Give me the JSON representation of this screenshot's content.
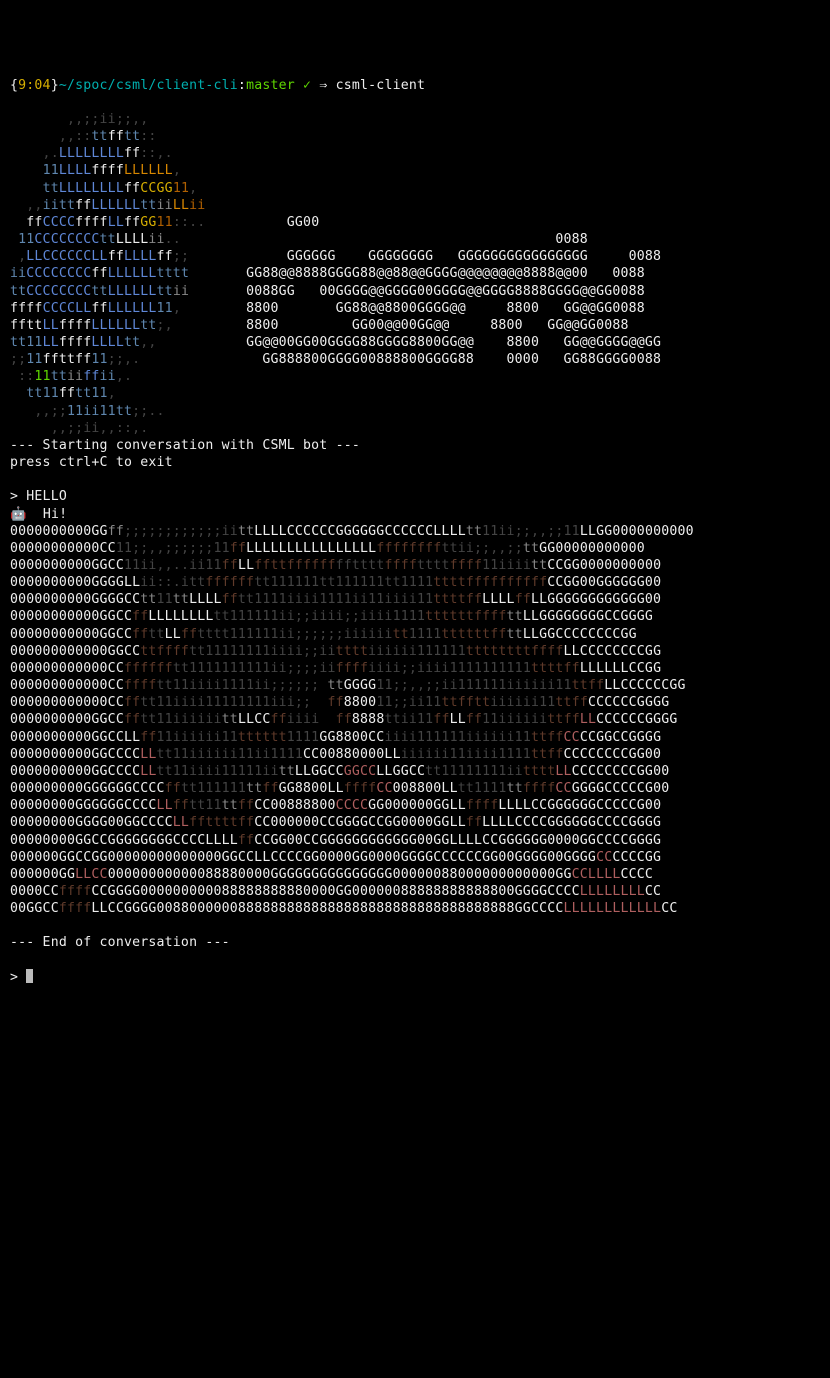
{
  "prompt": {
    "time_open": "{",
    "time": "9:04",
    "time_close": "}",
    "path": "~/spoc/csml/client-cli",
    "sep": ":",
    "branch": "master",
    "status": " ✓",
    "arrow": " ⇒ ",
    "command": "csml-client"
  },
  "logo": {
    "l01": "       ,,;;ii;;,,",
    "l02a": "      ,,::",
    "l02b": "tt",
    "l02c": "ff",
    "l02d": "tt",
    "l02e": "::",
    "l03a": "    ,.",
    "l03b": "LLLLLLLL",
    "l03c": "ff",
    "l03d": "::,.",
    "l04a": "    ",
    "l04b": "11",
    "l04c": "LLLL",
    "l04d": "ffff",
    "l04e": "LLLLLL",
    "l04f": ",",
    "l05a": "    ",
    "l05b": "tt",
    "l05c": "LLLLLLLL",
    "l05d": "ff",
    "l05e": "CCGG",
    "l05f": "11",
    "l05g": ",",
    "l06a": "  ,,",
    "l06b": "iitt",
    "l06c": "ff",
    "l06d": "LLLLLL",
    "l06e": "tt",
    "l06f": "ii",
    "l06g": "LL",
    "l06h": "ii",
    "l07a": "  ",
    "l07b": "ff",
    "l07c": "CCCC",
    "l07d": "ffff",
    "l07e": "LL",
    "l07f": "ff",
    "l07g": "GG",
    "l07h": "11",
    "l07i": "::..",
    "l07z": "          GG00",
    "l08a": " ",
    "l08b": "11",
    "l08c": "CCCCCCCC",
    "l08d": "tt",
    "l08e": "LLLL",
    "l08f": "ii",
    "l08g": "..",
    "l08z": "           0088",
    "l09a": " ,",
    "l09b": "LL",
    "l09c": "CCCCCC",
    "l09d": "LL",
    "l09e": "ff",
    "l09f": "LLLL",
    "l09g": "ff",
    "l09h": ";;",
    "l09z": "GGGGGG    GGGGGGGG   GGGGGGGGGGGGGGGG     0088",
    "l10a": "ii",
    "l10b": "CCCCCCCC",
    "l10c": "ff",
    "l10d": "LLLLLL",
    "l10e": "tttt",
    "l10z": "GG88@@8888GGGG88@@88@@GGGG@@@@@@@@8888@@00   0088",
    "l11a": "tt",
    "l11b": "CCCCCCCC",
    "l11c": "tt",
    "l11d": "LLLLLL",
    "l11e": "tt",
    "l11f": "ii",
    "l11z": "0088GG   00GGGG@@GGGG00GGGG@@GGGG8888GGGG@@GG0088",
    "l12a": "ffff",
    "l12b": "CCCC",
    "l12c": "LL",
    "l12d": "ff",
    "l12e": "LLLLLL",
    "l12f": "11",
    "l12g": ",",
    "l12z": "8800       GG88@@8800GGGG@@     8800   GG@@GG0088",
    "l13a": "fftt",
    "l13b": "LL",
    "l13c": "ffff",
    "l13d": "LLLLLL",
    "l13e": "tt",
    "l13f": ";,",
    "l13z": "8800         GG00@@00GG@@     8800   GG@@GG0088",
    "l14a": "tt",
    "l14b": "11",
    "l14c": "LL",
    "l14d": "ffff",
    "l14e": "LLLL",
    "l14f": "tt",
    "l14g": ",,",
    "l14z": "GG@@00GG00GGGG88GGGG8800GG@@    8800   GG@@GGGG@@GG",
    "l15a": ";;",
    "l15b": "11",
    "l15c": "fftt",
    "l15d": "ff",
    "l15e": "11",
    "l15f": ";;,.",
    "l15z": "GG888800GGGG00888800GGGG88    0000   GG88GGGG0088",
    "l16a": " ::",
    "l16b": "11",
    "l16c": "tt",
    "l16d": "ii",
    "l16e": "ff",
    "l16f": "ii",
    "l16g": ",.",
    "l17a": "  ",
    "l17b": "tt",
    "l17c": "11",
    "l17d": "ff",
    "l17e": "tt",
    "l17f": "11",
    "l17g": ",",
    "l18a": "   ,,;;",
    "l18b": "11",
    "l18c": "ii",
    "l18d": "11",
    "l18e": "tt",
    "l18f": ";;..",
    "l19": "     ,,;;ii,,::,."
  },
  "conv": {
    "start": "--- Starting conversation with CSML bot ---",
    "exit": "press ctrl+C to exit",
    "user_prefix": "> ",
    "user_msg": "HELLO",
    "bot_icon": "🤖",
    "bot_msg": "  Hi!",
    "end": "--- End of conversation ---"
  },
  "art": [
    {
      "p": [
        {
          "c": "c-white",
          "t": "0000000000GG"
        },
        {
          "c": "c-grey",
          "t": "ff"
        },
        {
          "c": "c-dim",
          "t": ";;;;;;;;;;;;ii"
        },
        {
          "c": "c-grey",
          "t": "tt"
        },
        {
          "c": "c-white",
          "t": "LLLLCCCCCCGGGGGGCCCCCCLLLL"
        },
        {
          "c": "c-grey",
          "t": "tt"
        },
        {
          "c": "c-dim",
          "t": "11ii;;,,;;11"
        },
        {
          "c": "c-white",
          "t": "LLGG0000000000"
        }
      ]
    },
    {
      "p": [
        {
          "c": "c-white",
          "t": "00000000000CC"
        },
        {
          "c": "c-dim",
          "t": "11;;,,;;;;;;11"
        },
        {
          "c": "c-brown",
          "t": "ff"
        },
        {
          "c": "c-white",
          "t": "LLLLLLLLLLLLLLLL"
        },
        {
          "c": "c-brown",
          "t": "ffffffff"
        },
        {
          "c": "c-dim",
          "t": "ttii;;,,;;"
        },
        {
          "c": "c-grey",
          "t": "tt"
        },
        {
          "c": "c-white",
          "t": "GG00000000000"
        }
      ]
    },
    {
      "p": [
        {
          "c": "c-white",
          "t": "0000000000GGCC"
        },
        {
          "c": "c-dim",
          "t": "11ii,,..ii11"
        },
        {
          "c": "c-brown",
          "t": "ff"
        },
        {
          "c": "c-white",
          "t": "LL"
        },
        {
          "c": "c-brown",
          "t": "fftt"
        },
        {
          "c": "c-brown",
          "t": "ffffff"
        },
        {
          "c": "c-dim",
          "t": "fftttt"
        },
        {
          "c": "c-brown",
          "t": "ffff"
        },
        {
          "c": "c-dim",
          "t": "tttt"
        },
        {
          "c": "c-brown",
          "t": "ffff"
        },
        {
          "c": "c-dim",
          "t": "11iiii"
        },
        {
          "c": "c-grey",
          "t": "tt"
        },
        {
          "c": "c-white",
          "t": "CCGG0000000000"
        }
      ]
    },
    {
      "p": [
        {
          "c": "c-white",
          "t": "0000000000GGGGLL"
        },
        {
          "c": "c-dim",
          "t": "ii::.itt"
        },
        {
          "c": "c-brown",
          "t": "ffffff"
        },
        {
          "c": "c-dim",
          "t": "tt111111tt111111tt1111"
        },
        {
          "c": "c-brown",
          "t": "tttt"
        },
        {
          "c": "c-brown",
          "t": "ffff"
        },
        {
          "c": "c-brown",
          "t": "ffffff"
        },
        {
          "c": "c-white",
          "t": "CCGG00GGGGGG00"
        }
      ]
    },
    {
      "p": [
        {
          "c": "c-white",
          "t": "0000000000GGGGCC"
        },
        {
          "c": "c-grey",
          "t": "tt"
        },
        {
          "c": "c-dim",
          "t": "11"
        },
        {
          "c": "c-grey",
          "t": "tt"
        },
        {
          "c": "c-white",
          "t": "LLLL"
        },
        {
          "c": "c-brown",
          "t": "ff"
        },
        {
          "c": "c-dim",
          "t": "tt1111iiii1111ii11iiii11"
        },
        {
          "c": "c-brown",
          "t": "tttt"
        },
        {
          "c": "c-brown",
          "t": "ff"
        },
        {
          "c": "c-white",
          "t": "LLLL"
        },
        {
          "c": "c-brown",
          "t": "ff"
        },
        {
          "c": "c-white",
          "t": "LLGGGGGGGGGGGG00"
        }
      ]
    },
    {
      "p": [
        {
          "c": "c-white",
          "t": "00000000000GGCC"
        },
        {
          "c": "c-brown",
          "t": "ff"
        },
        {
          "c": "c-white",
          "t": "LLLLLLLL"
        },
        {
          "c": "c-dim",
          "t": "tt111111ii;;iiii;;iiii1111"
        },
        {
          "c": "c-brown",
          "t": "tttttt"
        },
        {
          "c": "c-brown",
          "t": "ffff"
        },
        {
          "c": "c-grey",
          "t": "tt"
        },
        {
          "c": "c-white",
          "t": "LLGGGGGGGGCCGGGG"
        }
      ]
    },
    {
      "p": [
        {
          "c": "c-white",
          "t": "00000000000GGCC"
        },
        {
          "c": "c-brown",
          "t": "ff"
        },
        {
          "c": "c-dim",
          "t": "tt"
        },
        {
          "c": "c-white",
          "t": "LL"
        },
        {
          "c": "c-brown",
          "t": "ff"
        },
        {
          "c": "c-dim",
          "t": "tttt111111ii;;;;;;iiiiii"
        },
        {
          "c": "c-brown",
          "t": "tt"
        },
        {
          "c": "c-dim",
          "t": "1111"
        },
        {
          "c": "c-brown",
          "t": "tttttt"
        },
        {
          "c": "c-brown",
          "t": "ff"
        },
        {
          "c": "c-grey",
          "t": "tt"
        },
        {
          "c": "c-white",
          "t": "LLGGCCCCCCCCGG"
        }
      ]
    },
    {
      "p": [
        {
          "c": "c-white",
          "t": "000000000000GGCC"
        },
        {
          "c": "c-brown",
          "t": "tt"
        },
        {
          "c": "c-brown",
          "t": "ffff"
        },
        {
          "c": "c-dim",
          "t": "tt11111111iiii;;ii"
        },
        {
          "c": "c-brown",
          "t": "tttt"
        },
        {
          "c": "c-dim",
          "t": "iiiiii111111"
        },
        {
          "c": "c-brown",
          "t": "tttttttt"
        },
        {
          "c": "c-brown",
          "t": "ffff"
        },
        {
          "c": "c-white",
          "t": "LLCCCCCCCCGG"
        }
      ]
    },
    {
      "p": [
        {
          "c": "c-white",
          "t": "000000000000CC"
        },
        {
          "c": "c-brown",
          "t": "ffffff"
        },
        {
          "c": "c-dim",
          "t": "tt1111111111ii;;;;ii"
        },
        {
          "c": "c-brown",
          "t": "ffff"
        },
        {
          "c": "c-dim",
          "t": "iiii;;iiii1111111111"
        },
        {
          "c": "c-brown",
          "t": "tttt"
        },
        {
          "c": "c-brown",
          "t": "ff"
        },
        {
          "c": "c-white",
          "t": "LLLLLLCCGG"
        }
      ]
    },
    {
      "p": [
        {
          "c": "c-white",
          "t": "000000000000CC"
        },
        {
          "c": "c-brown",
          "t": "ffff"
        },
        {
          "c": "c-dim",
          "t": "tt11iiii1111ii;;;;;; "
        },
        {
          "c": "c-grey",
          "t": "tt"
        },
        {
          "c": "c-white",
          "t": "GGGG"
        },
        {
          "c": "c-dim",
          "t": "11;;,,;;ii111111iiiiii11"
        },
        {
          "c": "c-brown",
          "t": "tt"
        },
        {
          "c": "c-brown",
          "t": "ff"
        },
        {
          "c": "c-white",
          "t": "LLCCCCCCGG"
        }
      ]
    },
    {
      "p": [
        {
          "c": "c-white",
          "t": "000000000000CC"
        },
        {
          "c": "c-brown",
          "t": "ff"
        },
        {
          "c": "c-dim",
          "t": "tt11iiii11111111iii;;  "
        },
        {
          "c": "c-brown",
          "t": "ff"
        },
        {
          "c": "c-white",
          "t": "8800"
        },
        {
          "c": "c-dim",
          "t": "11;;ii11"
        },
        {
          "c": "c-brown",
          "t": "ttfftt"
        },
        {
          "c": "c-dim",
          "t": "iiiiii11"
        },
        {
          "c": "c-brown",
          "t": "tt"
        },
        {
          "c": "c-brown",
          "t": "ff"
        },
        {
          "c": "c-white",
          "t": "CCCCCCGGGG"
        }
      ]
    },
    {
      "p": [
        {
          "c": "c-white",
          "t": "0000000000GGCC"
        },
        {
          "c": "c-brown",
          "t": "ff"
        },
        {
          "c": "c-dim",
          "t": "tt11iiiiii"
        },
        {
          "c": "c-grey",
          "t": "tt"
        },
        {
          "c": "c-white",
          "t": "LLCC"
        },
        {
          "c": "c-brown",
          "t": "ff"
        },
        {
          "c": "c-dim",
          "t": "iiii  "
        },
        {
          "c": "c-brown",
          "t": "ff"
        },
        {
          "c": "c-white",
          "t": "8888"
        },
        {
          "c": "c-dim",
          "t": "ttii11"
        },
        {
          "c": "c-brown",
          "t": "ff"
        },
        {
          "c": "c-white",
          "t": "LL"
        },
        {
          "c": "c-brown",
          "t": "ff"
        },
        {
          "c": "c-dim",
          "t": "11iiiiii"
        },
        {
          "c": "c-brown",
          "t": "tt"
        },
        {
          "c": "c-brown",
          "t": "ff"
        },
        {
          "c": "c-red",
          "t": "LL"
        },
        {
          "c": "c-white",
          "t": "CCCCCCGGGG"
        }
      ]
    },
    {
      "p": [
        {
          "c": "c-white",
          "t": "0000000000GGCCLL"
        },
        {
          "c": "c-brown",
          "t": "ff"
        },
        {
          "c": "c-dim",
          "t": "11iiiiii11"
        },
        {
          "c": "c-brown",
          "t": "tttttt"
        },
        {
          "c": "c-dim",
          "t": "1111"
        },
        {
          "c": "c-white",
          "t": "GG8800CC"
        },
        {
          "c": "c-dim",
          "t": "iiii111111iiiiii11"
        },
        {
          "c": "c-brown",
          "t": "tt"
        },
        {
          "c": "c-brown",
          "t": "ff"
        },
        {
          "c": "c-red",
          "t": "CC"
        },
        {
          "c": "c-white",
          "t": "CCGGCCGGGG"
        }
      ]
    },
    {
      "p": [
        {
          "c": "c-white",
          "t": "0000000000GGCCCC"
        },
        {
          "c": "c-red",
          "t": "LL"
        },
        {
          "c": "c-dim",
          "t": "tt11iiiiii11ii1111"
        },
        {
          "c": "c-white",
          "t": "CC00880000LL"
        },
        {
          "c": "c-dim",
          "t": "iiiiii11iiii1111"
        },
        {
          "c": "c-brown",
          "t": "tt"
        },
        {
          "c": "c-brown",
          "t": "ff"
        },
        {
          "c": "c-white",
          "t": "CCCCCCCCGG00"
        }
      ]
    },
    {
      "p": [
        {
          "c": "c-white",
          "t": "0000000000GGCCCC"
        },
        {
          "c": "c-red",
          "t": "LL"
        },
        {
          "c": "c-dim",
          "t": "tt11iiii11111ii"
        },
        {
          "c": "c-grey",
          "t": "tt"
        },
        {
          "c": "c-white",
          "t": "LLGGCC"
        },
        {
          "c": "c-red",
          "t": "GGCC"
        },
        {
          "c": "c-white",
          "t": "LLGGCC"
        },
        {
          "c": "c-dim",
          "t": "tt11111111ii"
        },
        {
          "c": "c-brown",
          "t": "tttt"
        },
        {
          "c": "c-red",
          "t": "LL"
        },
        {
          "c": "c-white",
          "t": "CCCCCCCCGG00"
        }
      ]
    },
    {
      "p": [
        {
          "c": "c-white",
          "t": "000000000GGGGGGCCCC"
        },
        {
          "c": "c-brown",
          "t": "ff"
        },
        {
          "c": "c-dim",
          "t": "tt111111"
        },
        {
          "c": "c-grey",
          "t": "tt"
        },
        {
          "c": "c-brown",
          "t": "ff"
        },
        {
          "c": "c-white",
          "t": "GG8800LL"
        },
        {
          "c": "c-brown",
          "t": "ffff"
        },
        {
          "c": "c-red",
          "t": "CC"
        },
        {
          "c": "c-white",
          "t": "008800LL"
        },
        {
          "c": "c-dim",
          "t": "tt1111"
        },
        {
          "c": "c-grey",
          "t": "tt"
        },
        {
          "c": "c-brown",
          "t": "ffff"
        },
        {
          "c": "c-red",
          "t": "CC"
        },
        {
          "c": "c-white",
          "t": "GGGGCCCCCG00"
        }
      ]
    },
    {
      "p": [
        {
          "c": "c-white",
          "t": "00000000GGGGGGCCCC"
        },
        {
          "c": "c-red",
          "t": "LL"
        },
        {
          "c": "c-brown",
          "t": "ff"
        },
        {
          "c": "c-dim",
          "t": "tt11"
        },
        {
          "c": "c-grey",
          "t": "tt"
        },
        {
          "c": "c-brown",
          "t": "ff"
        },
        {
          "c": "c-white",
          "t": "CC00888800"
        },
        {
          "c": "c-red",
          "t": "CCCC"
        },
        {
          "c": "c-white",
          "t": "GG000000GG"
        },
        {
          "c": "c-white",
          "t": "LL"
        },
        {
          "c": "c-brown",
          "t": "ffff"
        },
        {
          "c": "c-white",
          "t": "LLLLCCGGGGGGCCCCCG00"
        }
      ]
    },
    {
      "p": [
        {
          "c": "c-white",
          "t": "00000000GGGG00GGCCCC"
        },
        {
          "c": "c-red",
          "t": "LL"
        },
        {
          "c": "c-brown",
          "t": "ff"
        },
        {
          "c": "c-brown",
          "t": "tttt"
        },
        {
          "c": "c-brown",
          "t": "ff"
        },
        {
          "c": "c-white",
          "t": "CC000000CCGGGGCCGG0000GG"
        },
        {
          "c": "c-white",
          "t": "LL"
        },
        {
          "c": "c-brown",
          "t": "ff"
        },
        {
          "c": "c-white",
          "t": "LLLLCCCCGGGGGGCCCCGGGG"
        }
      ]
    },
    {
      "p": [
        {
          "c": "c-white",
          "t": "00000000GGCCGGGGGGGGCCCCLLLL"
        },
        {
          "c": "c-brown",
          "t": "ff"
        },
        {
          "c": "c-white",
          "t": "CCGG00CCGGGGGGGGGGGG00GGLLLLCCGGGGGG0000GGCCCCGGGG"
        }
      ]
    },
    {
      "p": [
        {
          "c": "c-white",
          "t": "000000GGCCGG00000000000000GGCCLLCCCCGG0000GG0000GGGGCCCCCCGG00GGGG00GGGG"
        },
        {
          "c": "c-red",
          "t": "CC"
        },
        {
          "c": "c-white",
          "t": "CCCCGG"
        }
      ]
    },
    {
      "p": [
        {
          "c": "c-white",
          "t": "000000GG"
        },
        {
          "c": "c-red",
          "t": "LLCC"
        },
        {
          "c": "c-white",
          "t": "00000000000088880000GGGGGGGGGGGGGGG00000088000000000000GG"
        },
        {
          "c": "c-red",
          "t": "CCLLLL"
        },
        {
          "c": "c-white",
          "t": "CCCC"
        }
      ]
    },
    {
      "p": [
        {
          "c": "c-white",
          "t": "0000CC"
        },
        {
          "c": "c-brown",
          "t": "ffff"
        },
        {
          "c": "c-white",
          "t": "CCGGGG000000000088888888880000GG00000088888888888800GGGGCCCC"
        },
        {
          "c": "c-red",
          "t": "LLLLLLLL"
        },
        {
          "c": "c-white",
          "t": "CC"
        }
      ]
    },
    {
      "p": [
        {
          "c": "c-white",
          "t": "00GGCC"
        },
        {
          "c": "c-brown",
          "t": "ffff"
        },
        {
          "c": "c-white",
          "t": "LLCCGGGG00880000008888888888888888888888888888888888GGCCCC"
        },
        {
          "c": "c-red",
          "t": "LLLLLLLLLLLL"
        },
        {
          "c": "c-white",
          "t": "CC"
        }
      ]
    }
  ]
}
